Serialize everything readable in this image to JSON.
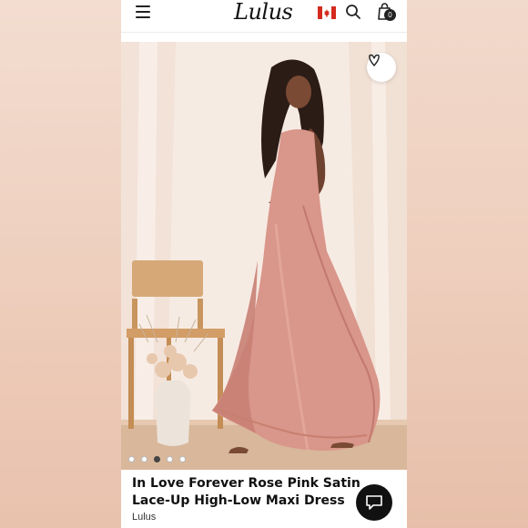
{
  "header": {
    "logo_text": "Lulus",
    "cart_count": "0",
    "icons": [
      "menu-icon",
      "canada-flag-icon",
      "search-icon",
      "shopping-bag-icon"
    ]
  },
  "product": {
    "title": "In Love Forever Rose Pink Satin Lace-Up High-Low Maxi Dress",
    "brand": "Lulus",
    "image_count": 5,
    "active_image_index": 2,
    "wishlist_icon": "heart-icon"
  },
  "chat": {
    "icon": "chat-bubble-icon"
  },
  "colors": {
    "dress": "#d9968a",
    "background": "#f5e6dc",
    "accent_dark": "#111111",
    "flag_red": "#d52b1e"
  }
}
